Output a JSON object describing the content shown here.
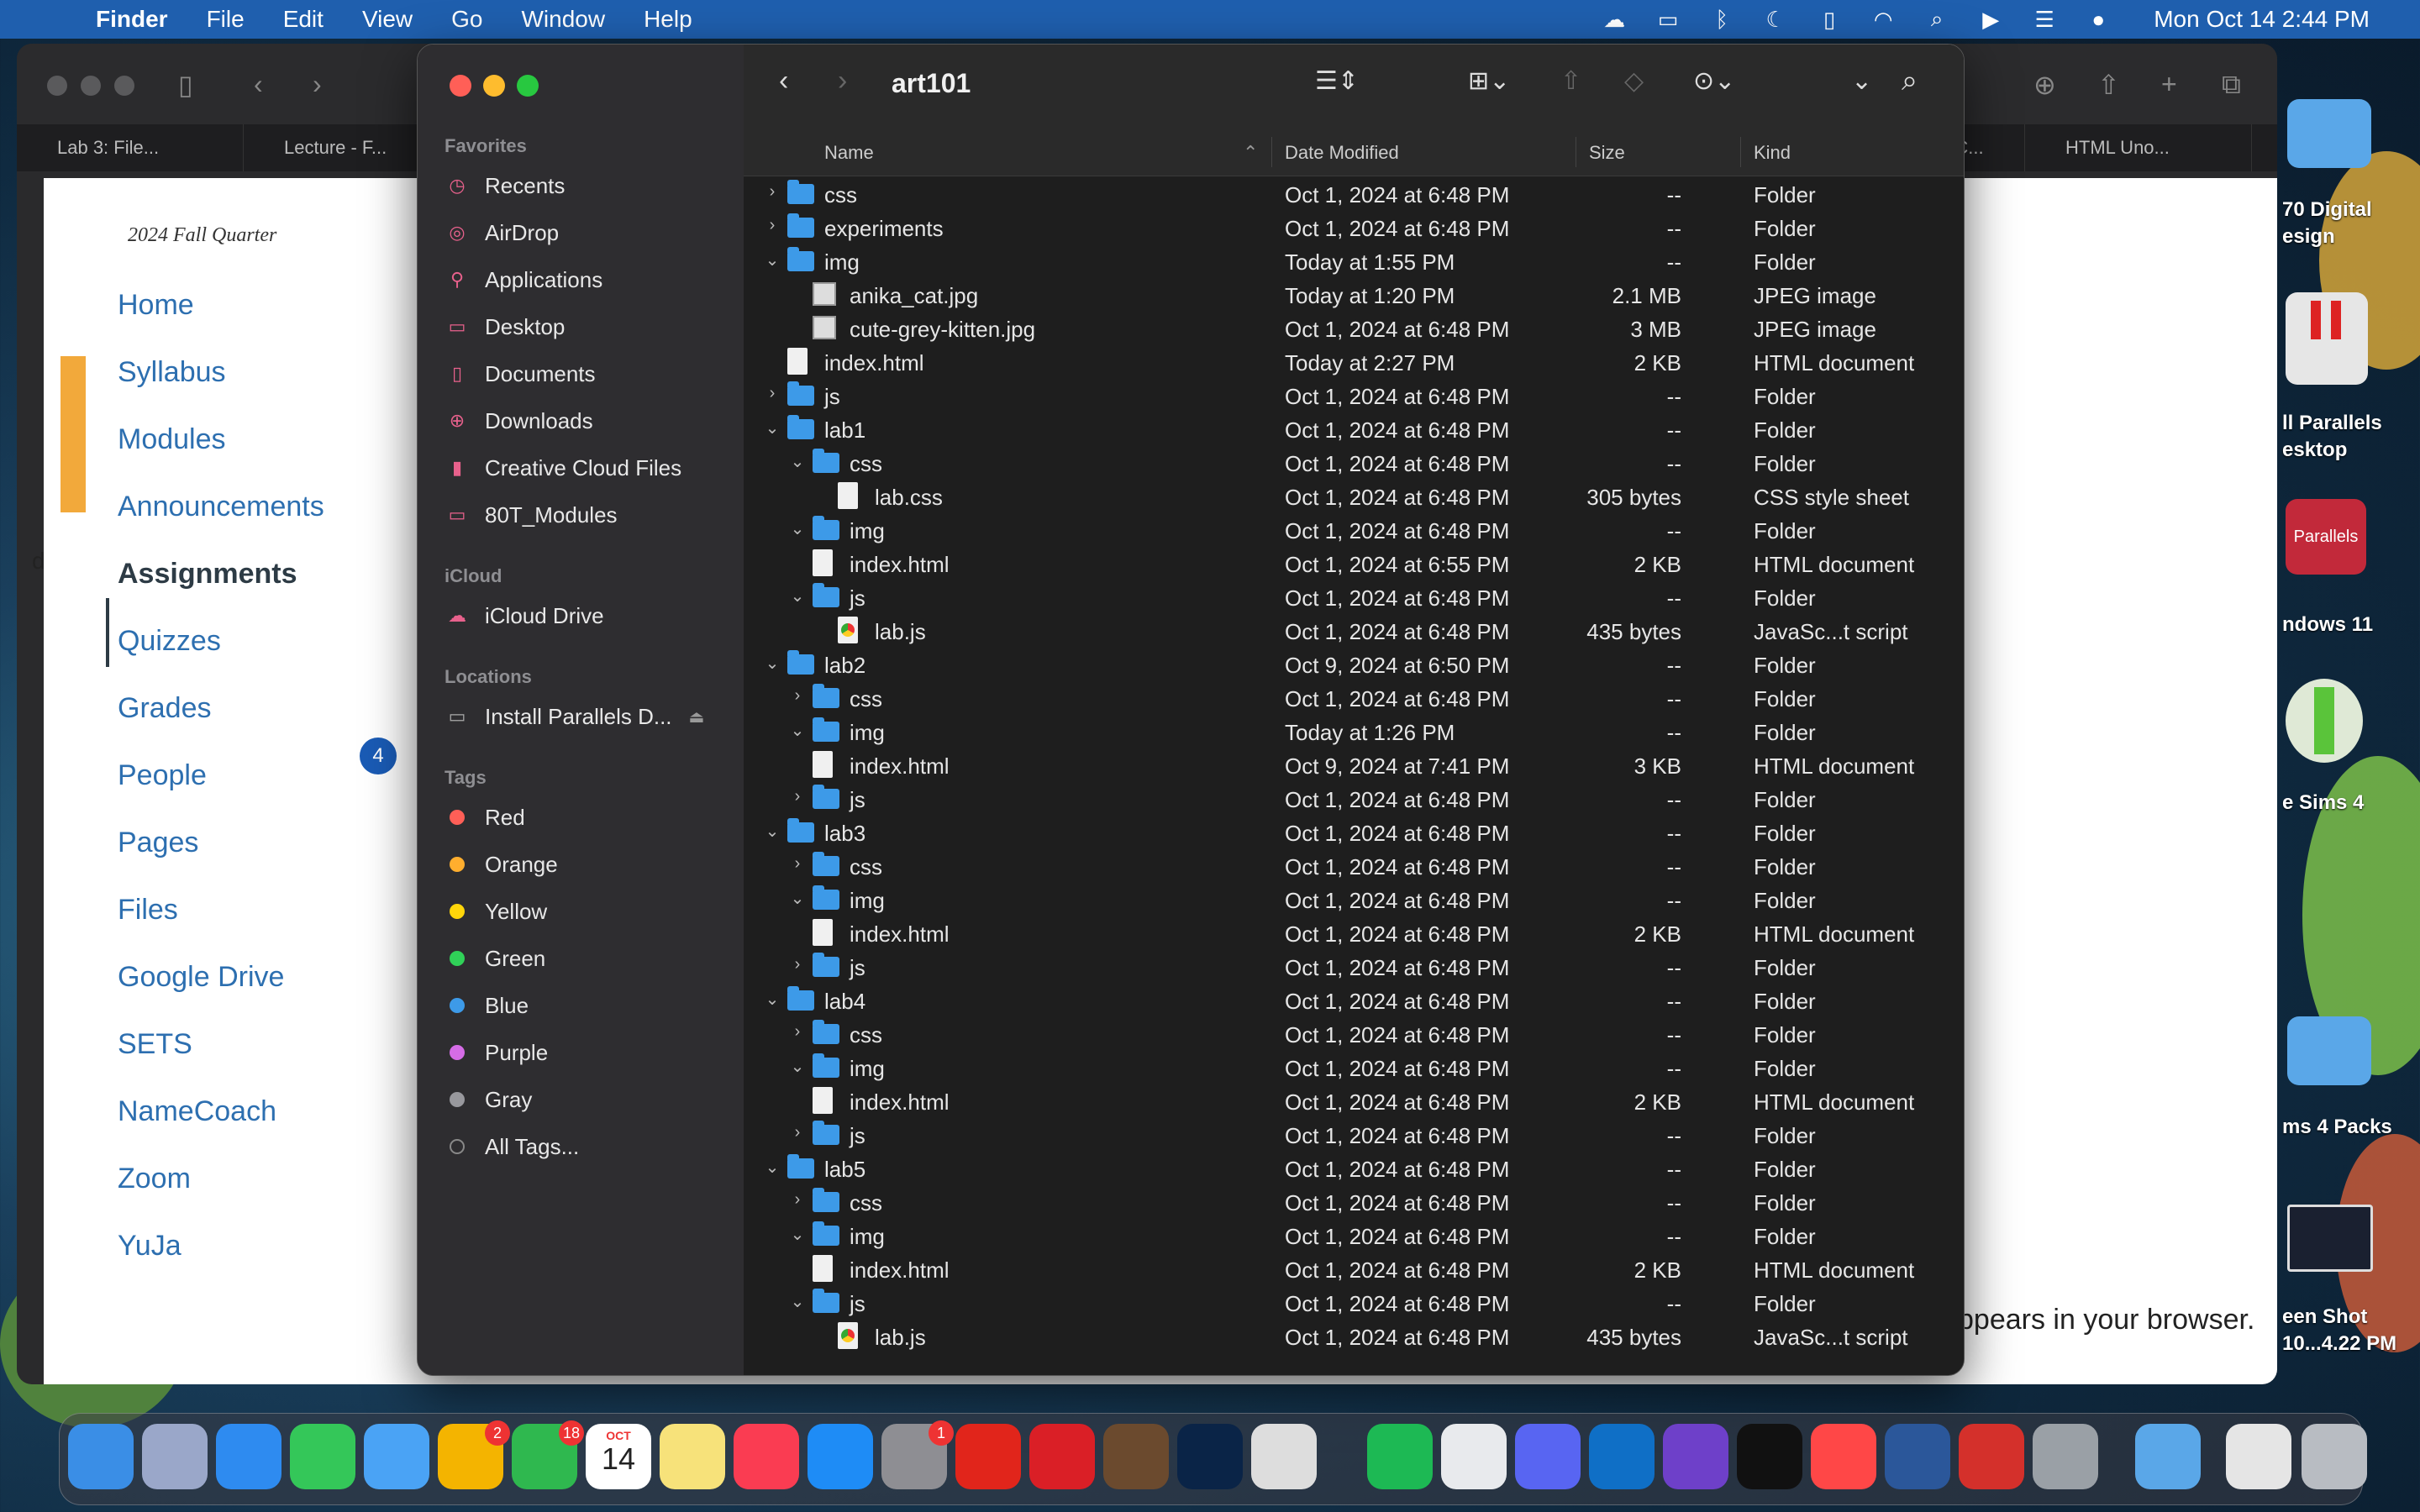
{
  "menubar": {
    "app_name": "Finder",
    "menus": [
      "File",
      "Edit",
      "View",
      "Go",
      "Window",
      "Help"
    ],
    "clock": "Mon Oct 14  2:44 PM",
    "status_icons": [
      "creative-cloud-icon",
      "display-icon",
      "bluetooth-icon",
      "moon-icon",
      "battery-icon",
      "wifi-icon",
      "search-icon",
      "play-icon",
      "control-center-icon",
      "siri-icon"
    ]
  },
  "browser": {
    "tabs": [
      "Lab 3: File...",
      "Lecture - F...",
      "g C...",
      "HTML Uno..."
    ],
    "quarter": "2024 Fall Quarter",
    "nav": [
      "Home",
      "Syllabus",
      "Modules",
      "Announcements",
      "Assignments",
      "Quizzes",
      "Grades",
      "People",
      "Pages",
      "Files",
      "Google Drive",
      "SETS",
      "NameCoach",
      "Zoom",
      "YuJa"
    ],
    "active_nav": "Assignments",
    "grades_badge": "4",
    "body_text": "ppears in your browser.",
    "left_edge_letter": "d"
  },
  "desktop": {
    "labels": [
      "70 Digital\nesign",
      "ll Parallels\nesktop",
      "ndows 11",
      "e Sims 4",
      "ms 4 Packs",
      "een Shot\n10...4.22 PM"
    ],
    "parallels_label": "Parallels"
  },
  "finder": {
    "title": "art101",
    "sidebar": {
      "favorites_heading": "Favorites",
      "favorites": [
        {
          "label": "Recents",
          "icon": "clock-icon"
        },
        {
          "label": "AirDrop",
          "icon": "airdrop-icon"
        },
        {
          "label": "Applications",
          "icon": "applications-icon"
        },
        {
          "label": "Desktop",
          "icon": "desktop-icon"
        },
        {
          "label": "Documents",
          "icon": "document-icon"
        },
        {
          "label": "Downloads",
          "icon": "download-icon"
        },
        {
          "label": "Creative Cloud Files",
          "icon": "file-icon"
        },
        {
          "label": "80T_Modules",
          "icon": "folder-icon"
        }
      ],
      "icloud_heading": "iCloud",
      "icloud": [
        {
          "label": "iCloud Drive",
          "icon": "cloud-icon"
        }
      ],
      "locations_heading": "Locations",
      "locations": [
        {
          "label": "Install Parallels D...",
          "icon": "disk-icon"
        }
      ],
      "tags_heading": "Tags",
      "tags": [
        {
          "label": "Red",
          "color": "#ff5f57"
        },
        {
          "label": "Orange",
          "color": "#ffae2e"
        },
        {
          "label": "Yellow",
          "color": "#ffd60a"
        },
        {
          "label": "Green",
          "color": "#30d158"
        },
        {
          "label": "Blue",
          "color": "#3d9ae8"
        },
        {
          "label": "Purple",
          "color": "#d56ce6"
        },
        {
          "label": "Gray",
          "color": "#98989d"
        },
        {
          "label": "All Tags...",
          "color": ""
        }
      ]
    },
    "columns": {
      "name": "Name",
      "date": "Date Modified",
      "size": "Size",
      "kind": "Kind"
    },
    "rows": [
      {
        "indent": 0,
        "disc": "right",
        "type": "folder",
        "name": "css",
        "date": "Oct 1, 2024 at 6:48 PM",
        "size": "--",
        "kind": "Folder"
      },
      {
        "indent": 0,
        "disc": "right",
        "type": "folder",
        "name": "experiments",
        "date": "Oct 1, 2024 at 6:48 PM",
        "size": "--",
        "kind": "Folder"
      },
      {
        "indent": 0,
        "disc": "down",
        "type": "folder",
        "name": "img",
        "date": "Today at 1:55 PM",
        "size": "--",
        "kind": "Folder"
      },
      {
        "indent": 1,
        "disc": "",
        "type": "image",
        "name": "anika_cat.jpg",
        "date": "Today at 1:20 PM",
        "size": "2.1 MB",
        "kind": "JPEG image"
      },
      {
        "indent": 1,
        "disc": "",
        "type": "image",
        "name": "cute-grey-kitten.jpg",
        "date": "Oct 1, 2024 at 6:48 PM",
        "size": "3 MB",
        "kind": "JPEG image"
      },
      {
        "indent": 0,
        "disc": "",
        "type": "file",
        "name": "index.html",
        "date": "Today at 2:27 PM",
        "size": "2 KB",
        "kind": "HTML document"
      },
      {
        "indent": 0,
        "disc": "right",
        "type": "folder",
        "name": "js",
        "date": "Oct 1, 2024 at 6:48 PM",
        "size": "--",
        "kind": "Folder"
      },
      {
        "indent": 0,
        "disc": "down",
        "type": "folder",
        "name": "lab1",
        "date": "Oct 1, 2024 at 6:48 PM",
        "size": "--",
        "kind": "Folder"
      },
      {
        "indent": 1,
        "disc": "down",
        "type": "folder",
        "name": "css",
        "date": "Oct 1, 2024 at 6:48 PM",
        "size": "--",
        "kind": "Folder"
      },
      {
        "indent": 2,
        "disc": "",
        "type": "file",
        "name": "lab.css",
        "date": "Oct 1, 2024 at 6:48 PM",
        "size": "305 bytes",
        "kind": "CSS style sheet"
      },
      {
        "indent": 1,
        "disc": "down",
        "type": "folder",
        "name": "img",
        "date": "Oct 1, 2024 at 6:48 PM",
        "size": "--",
        "kind": "Folder"
      },
      {
        "indent": 1,
        "disc": "",
        "type": "file",
        "name": "index.html",
        "date": "Oct 1, 2024 at 6:55 PM",
        "size": "2 KB",
        "kind": "HTML document"
      },
      {
        "indent": 1,
        "disc": "down",
        "type": "folder",
        "name": "js",
        "date": "Oct 1, 2024 at 6:48 PM",
        "size": "--",
        "kind": "Folder"
      },
      {
        "indent": 2,
        "disc": "",
        "type": "js",
        "name": "lab.js",
        "date": "Oct 1, 2024 at 6:48 PM",
        "size": "435 bytes",
        "kind": "JavaSc...t script"
      },
      {
        "indent": 0,
        "disc": "down",
        "type": "folder",
        "name": "lab2",
        "date": "Oct 9, 2024 at 6:50 PM",
        "size": "--",
        "kind": "Folder"
      },
      {
        "indent": 1,
        "disc": "right",
        "type": "folder",
        "name": "css",
        "date": "Oct 1, 2024 at 6:48 PM",
        "size": "--",
        "kind": "Folder"
      },
      {
        "indent": 1,
        "disc": "down",
        "type": "folder",
        "name": "img",
        "date": "Today at 1:26 PM",
        "size": "--",
        "kind": "Folder"
      },
      {
        "indent": 1,
        "disc": "",
        "type": "file",
        "name": "index.html",
        "date": "Oct 9, 2024 at 7:41 PM",
        "size": "3 KB",
        "kind": "HTML document"
      },
      {
        "indent": 1,
        "disc": "right",
        "type": "folder",
        "name": "js",
        "date": "Oct 1, 2024 at 6:48 PM",
        "size": "--",
        "kind": "Folder"
      },
      {
        "indent": 0,
        "disc": "down",
        "type": "folder",
        "name": "lab3",
        "date": "Oct 1, 2024 at 6:48 PM",
        "size": "--",
        "kind": "Folder"
      },
      {
        "indent": 1,
        "disc": "right",
        "type": "folder",
        "name": "css",
        "date": "Oct 1, 2024 at 6:48 PM",
        "size": "--",
        "kind": "Folder"
      },
      {
        "indent": 1,
        "disc": "down",
        "type": "folder",
        "name": "img",
        "date": "Oct 1, 2024 at 6:48 PM",
        "size": "--",
        "kind": "Folder"
      },
      {
        "indent": 1,
        "disc": "",
        "type": "file",
        "name": "index.html",
        "date": "Oct 1, 2024 at 6:48 PM",
        "size": "2 KB",
        "kind": "HTML document"
      },
      {
        "indent": 1,
        "disc": "right",
        "type": "folder",
        "name": "js",
        "date": "Oct 1, 2024 at 6:48 PM",
        "size": "--",
        "kind": "Folder"
      },
      {
        "indent": 0,
        "disc": "down",
        "type": "folder",
        "name": "lab4",
        "date": "Oct 1, 2024 at 6:48 PM",
        "size": "--",
        "kind": "Folder"
      },
      {
        "indent": 1,
        "disc": "right",
        "type": "folder",
        "name": "css",
        "date": "Oct 1, 2024 at 6:48 PM",
        "size": "--",
        "kind": "Folder"
      },
      {
        "indent": 1,
        "disc": "down",
        "type": "folder",
        "name": "img",
        "date": "Oct 1, 2024 at 6:48 PM",
        "size": "--",
        "kind": "Folder"
      },
      {
        "indent": 1,
        "disc": "",
        "type": "file",
        "name": "index.html",
        "date": "Oct 1, 2024 at 6:48 PM",
        "size": "2 KB",
        "kind": "HTML document"
      },
      {
        "indent": 1,
        "disc": "right",
        "type": "folder",
        "name": "js",
        "date": "Oct 1, 2024 at 6:48 PM",
        "size": "--",
        "kind": "Folder"
      },
      {
        "indent": 0,
        "disc": "down",
        "type": "folder",
        "name": "lab5",
        "date": "Oct 1, 2024 at 6:48 PM",
        "size": "--",
        "kind": "Folder"
      },
      {
        "indent": 1,
        "disc": "right",
        "type": "folder",
        "name": "css",
        "date": "Oct 1, 2024 at 6:48 PM",
        "size": "--",
        "kind": "Folder"
      },
      {
        "indent": 1,
        "disc": "down",
        "type": "folder",
        "name": "img",
        "date": "Oct 1, 2024 at 6:48 PM",
        "size": "--",
        "kind": "Folder"
      },
      {
        "indent": 1,
        "disc": "",
        "type": "file",
        "name": "index.html",
        "date": "Oct 1, 2024 at 6:48 PM",
        "size": "2 KB",
        "kind": "HTML document"
      },
      {
        "indent": 1,
        "disc": "down",
        "type": "folder",
        "name": "js",
        "date": "Oct 1, 2024 at 6:48 PM",
        "size": "--",
        "kind": "Folder"
      },
      {
        "indent": 2,
        "disc": "",
        "type": "js",
        "name": "lab.js",
        "date": "Oct 1, 2024 at 6:48 PM",
        "size": "435 bytes",
        "kind": "JavaSc...t script"
      }
    ]
  },
  "dock": {
    "apps": [
      {
        "name": "finder-icon",
        "color": "#3a8ee6",
        "badge": ""
      },
      {
        "name": "launchpad-icon",
        "color": "#9aa7c9",
        "badge": ""
      },
      {
        "name": "safari-icon",
        "color": "#2e8bf0",
        "badge": ""
      },
      {
        "name": "messages-icon",
        "color": "#34c759",
        "badge": ""
      },
      {
        "name": "mail-icon",
        "color": "#4aa3f5",
        "badge": ""
      },
      {
        "name": "photos-icon",
        "color": "#f4b400",
        "badge": "2"
      },
      {
        "name": "facetime-icon",
        "color": "#2fb84f",
        "badge": "18"
      },
      {
        "name": "calendar-icon",
        "color": "#ffffff",
        "badge": ""
      },
      {
        "name": "notes-icon",
        "color": "#f7e27a",
        "badge": ""
      },
      {
        "name": "music-icon",
        "color": "#fa3c52",
        "badge": ""
      },
      {
        "name": "app-store-icon",
        "color": "#1e8cf6",
        "badge": ""
      },
      {
        "name": "system-settings-icon",
        "color": "#8e8e93",
        "badge": "1"
      },
      {
        "name": "scratch-icon",
        "color": "#e1251b",
        "badge": ""
      },
      {
        "name": "creative-cloud-icon",
        "color": "#da1f26",
        "badge": ""
      },
      {
        "name": "minecraft-icon",
        "color": "#6b4a2e",
        "badge": ""
      },
      {
        "name": "photoshop-icon",
        "color": "#0a2447",
        "badge": ""
      },
      {
        "name": "roblox-icon",
        "color": "#dddddd",
        "badge": ""
      },
      {
        "name": "spotify-icon",
        "color": "#1db954",
        "badge": ""
      },
      {
        "name": "chrome-icon",
        "color": "#e8eaed",
        "badge": ""
      },
      {
        "name": "discord-icon",
        "color": "#5865f2",
        "badge": ""
      },
      {
        "name": "vscode-icon",
        "color": "#0f6fc6",
        "badge": ""
      },
      {
        "name": "github-icon",
        "color": "#6e40c9",
        "badge": ""
      },
      {
        "name": "capcut-icon",
        "color": "#111111",
        "badge": ""
      },
      {
        "name": "ea-icon",
        "color": "#ff4747",
        "badge": ""
      },
      {
        "name": "word-icon",
        "color": "#2b579a",
        "badge": ""
      },
      {
        "name": "acrobat-icon",
        "color": "#d4302b",
        "badge": ""
      },
      {
        "name": "preview-icon",
        "color": "#9aa0a6",
        "badge": ""
      },
      {
        "name": "applications-folder-icon",
        "color": "#5aa7e8",
        "badge": ""
      },
      {
        "name": "document-stack-icon",
        "color": "#e5e5e5",
        "badge": ""
      },
      {
        "name": "trash-icon",
        "color": "#b8bcc2",
        "badge": ""
      }
    ],
    "calendar_month": "OCT",
    "calendar_day": "14"
  }
}
